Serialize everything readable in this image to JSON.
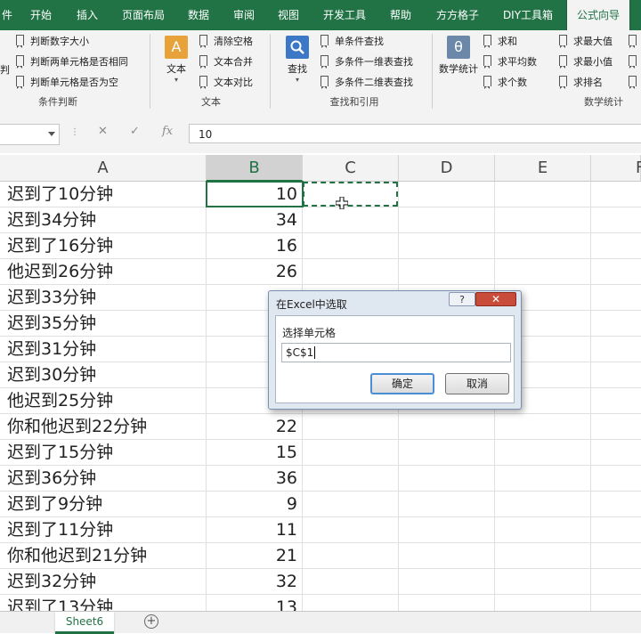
{
  "ribbon_tabs": [
    "件",
    "开始",
    "插入",
    "页面布局",
    "数据",
    "审阅",
    "视图",
    "开发工具",
    "帮助",
    "方方格子",
    "DIY工具箱",
    "公式向导"
  ],
  "active_tab": "公式向导",
  "groups": {
    "condition": {
      "partial_label": "判",
      "items": [
        "判断数字大小",
        "判断两单元格是否相同",
        "判断单元格是否为空"
      ],
      "label": "条件判断"
    },
    "text": {
      "big_button": "文本",
      "big_icon": "A",
      "items": [
        "清除空格",
        "文本合并",
        "文本对比"
      ],
      "label": "文本"
    },
    "lookup": {
      "big_button": "查找",
      "items": [
        "单条件查找",
        "多条件一维表查找",
        "多条件二维表查找"
      ],
      "label": "查找和引用"
    },
    "stats": {
      "big_button": "数学统计",
      "big_icon": "θ",
      "items_col1": [
        "求和",
        "求平均数",
        "求个数"
      ],
      "items_col2": [
        "求最大值",
        "求最小值",
        "求排名"
      ],
      "label": "数学统计"
    }
  },
  "formula_bar": {
    "name_box": "",
    "cancel_icon": "✕",
    "enter_icon": "✓",
    "fx_icon": "fx",
    "value": "10"
  },
  "columns": [
    "A",
    "B",
    "C",
    "D",
    "E",
    "F"
  ],
  "selected_column": "B",
  "rows": [
    {
      "a": "迟到了10分钟",
      "b": "10"
    },
    {
      "a": "迟到34分钟",
      "b": "34"
    },
    {
      "a": "迟到了16分钟",
      "b": "16"
    },
    {
      "a": "他迟到26分钟",
      "b": "26"
    },
    {
      "a": "迟到33分钟",
      "b": ""
    },
    {
      "a": "迟到35分钟",
      "b": ""
    },
    {
      "a": "迟到31分钟",
      "b": ""
    },
    {
      "a": "迟到30分钟",
      "b": ""
    },
    {
      "a": "他迟到25分钟",
      "b": ""
    },
    {
      "a": "你和他迟到22分钟",
      "b": "22"
    },
    {
      "a": "迟到了15分钟",
      "b": "15"
    },
    {
      "a": "迟到36分钟",
      "b": "36"
    },
    {
      "a": "迟到了9分钟",
      "b": "9"
    },
    {
      "a": "迟到了11分钟",
      "b": "11"
    },
    {
      "a": "你和他迟到21分钟",
      "b": "21"
    },
    {
      "a": "迟到32分钟",
      "b": "32"
    },
    {
      "a": "迟到了13分钟",
      "b": "13"
    }
  ],
  "dialog": {
    "title": "在Excel中选取",
    "help": "?",
    "close": "✕",
    "label": "选择单元格",
    "input_value": "$C$1",
    "ok": "确定",
    "cancel": "取消"
  },
  "sheet_tab": "Sheet6",
  "add_sheet": "+",
  "colors": {
    "accent": "#217346",
    "dialog_bg": "#dfe7f1",
    "close_button": "#c94c3b"
  }
}
